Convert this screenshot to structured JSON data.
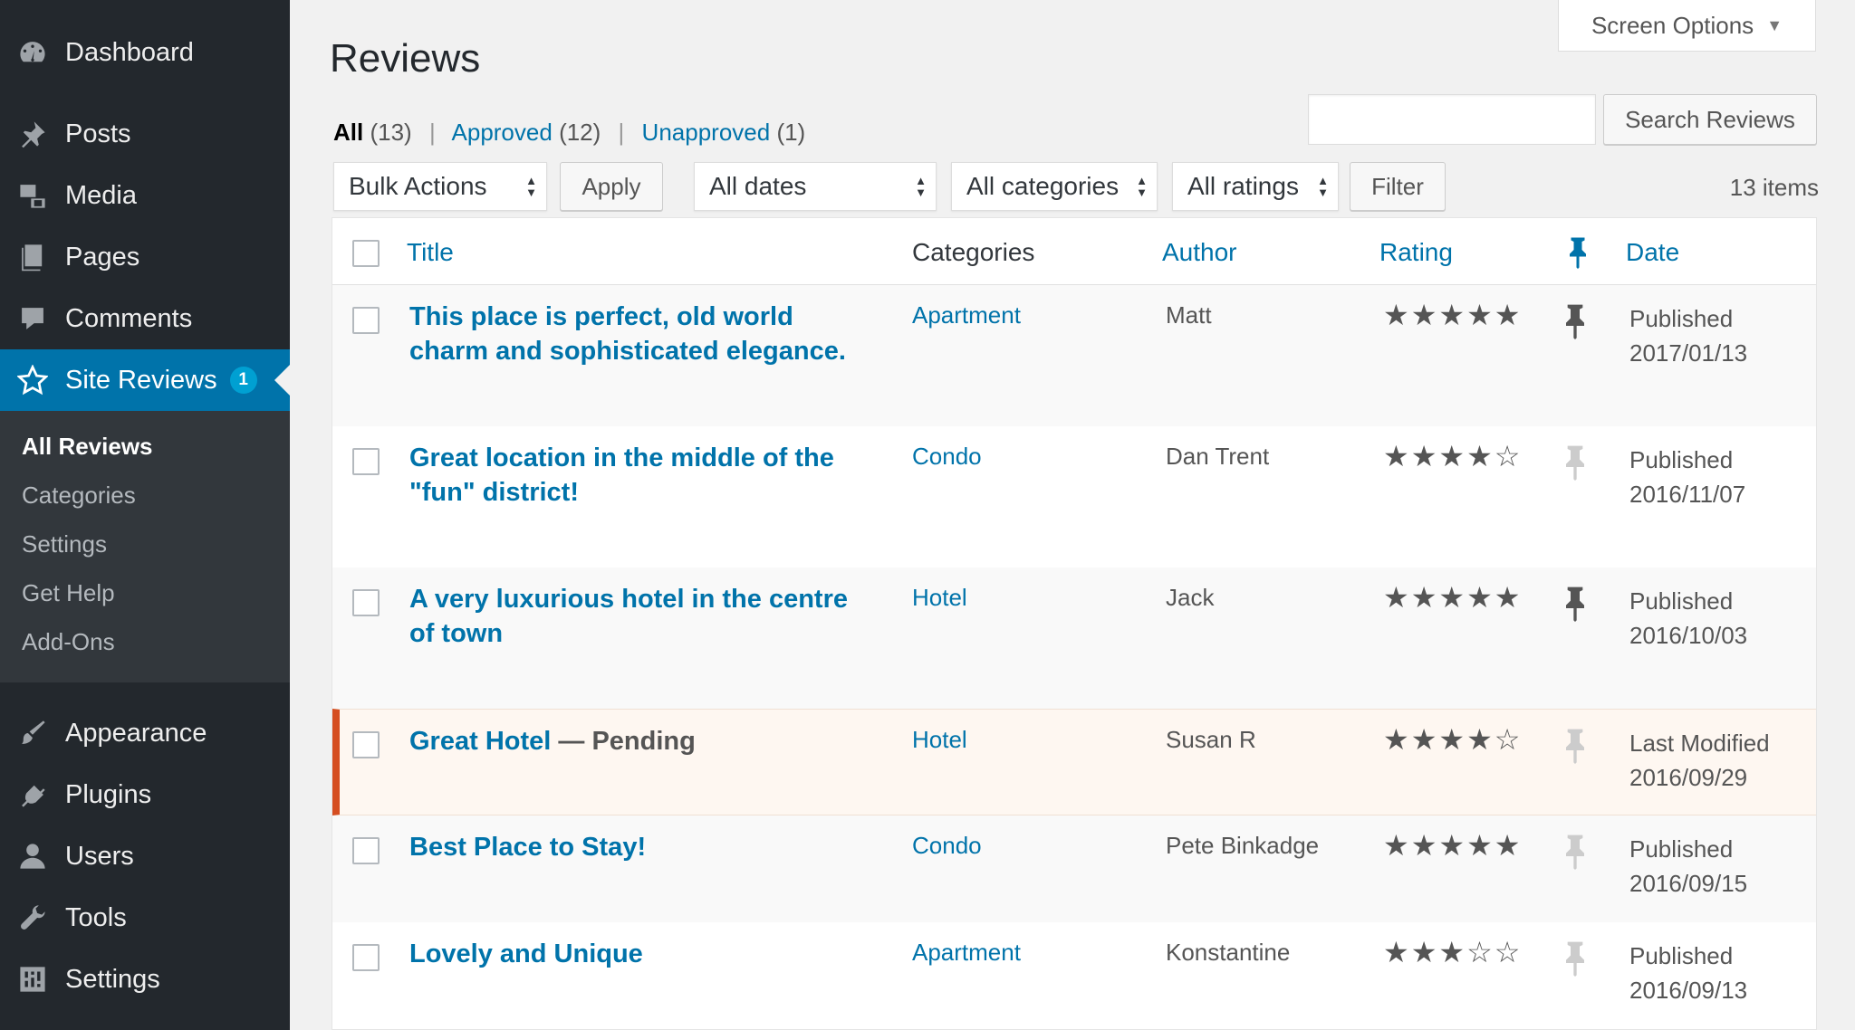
{
  "sidebar": {
    "top_items": [
      {
        "label": "Dashboard",
        "icon": "dashboard-icon"
      },
      {
        "label": "Posts",
        "icon": "pushpin-icon"
      },
      {
        "label": "Media",
        "icon": "media-icon"
      },
      {
        "label": "Pages",
        "icon": "pages-icon"
      },
      {
        "label": "Comments",
        "icon": "comment-icon"
      }
    ],
    "current": {
      "label": "Site Reviews",
      "badge": "1",
      "icon": "star-icon"
    },
    "submenu": [
      {
        "label": "All Reviews",
        "active": true
      },
      {
        "label": "Categories"
      },
      {
        "label": "Settings"
      },
      {
        "label": "Get Help"
      },
      {
        "label": "Add-Ons"
      }
    ],
    "bottom_items": [
      {
        "label": "Appearance",
        "icon": "paintbrush-icon"
      },
      {
        "label": "Plugins",
        "icon": "plug-icon"
      },
      {
        "label": "Users",
        "icon": "user-icon"
      },
      {
        "label": "Tools",
        "icon": "wrench-icon"
      },
      {
        "label": "Settings",
        "icon": "settings-icon"
      }
    ]
  },
  "header": {
    "screen_options": "Screen Options",
    "title": "Reviews"
  },
  "filters": {
    "all": "All",
    "all_count": "(13)",
    "approved": "Approved",
    "approved_count": "(12)",
    "unapproved": "Unapproved",
    "unapproved_count": "(1)",
    "separator": "|"
  },
  "search": {
    "value": "",
    "button": "Search Reviews"
  },
  "toolbar": {
    "bulk_actions": "Bulk Actions",
    "apply": "Apply",
    "dates": "All dates",
    "categories": "All categories",
    "ratings": "All ratings",
    "filter": "Filter",
    "items_count": "13 items"
  },
  "table": {
    "columns": {
      "title": "Title",
      "categories": "Categories",
      "author": "Author",
      "rating": "Rating",
      "date": "Date"
    },
    "rows": [
      {
        "title_1": "This place is perfect, old world",
        "title_2": "charm and sophisticated elegance.",
        "state": "",
        "category": "Apartment",
        "author": "Matt",
        "rating": 5,
        "stars": "★★★★★",
        "pinned": true,
        "status": "Published",
        "date": "2017/01/13"
      },
      {
        "title_1": "Great location in the middle of the",
        "title_2": "\"fun\" district!",
        "state": "",
        "category": "Condo",
        "author": "Dan Trent",
        "rating": 4,
        "stars": "★★★★☆",
        "pinned": false,
        "status": "Published",
        "date": "2016/11/07"
      },
      {
        "title_1": "A very luxurious hotel in the centre",
        "title_2": "of town",
        "state": "",
        "category": "Hotel",
        "author": "Jack",
        "rating": 5,
        "stars": "★★★★★",
        "pinned": true,
        "status": "Published",
        "date": "2016/10/03"
      },
      {
        "title_1": "Great Hotel",
        "title_2": "",
        "state": " — Pending",
        "category": "Hotel",
        "author": "Susan R",
        "rating": 4,
        "stars": "★★★★☆",
        "pinned": false,
        "status": "Last Modified",
        "date": "2016/09/29"
      },
      {
        "title_1": "Best Place to Stay!",
        "title_2": "",
        "state": "",
        "category": "Condo",
        "author": "Pete Binkadge",
        "rating": 5,
        "stars": "★★★★★",
        "pinned": false,
        "status": "Published",
        "date": "2016/09/15"
      },
      {
        "title_1": "Lovely and Unique",
        "title_2": "",
        "state": "",
        "category": "Apartment",
        "author": "Konstantine",
        "rating": 3,
        "stars": "★★★☆☆",
        "pinned": false,
        "status": "Published",
        "date": "2016/09/13"
      }
    ]
  },
  "colors": {
    "accent": "#0073aa",
    "sidebar": "#23282d",
    "pending": "#d54e21",
    "badge": "#00a0d2"
  }
}
